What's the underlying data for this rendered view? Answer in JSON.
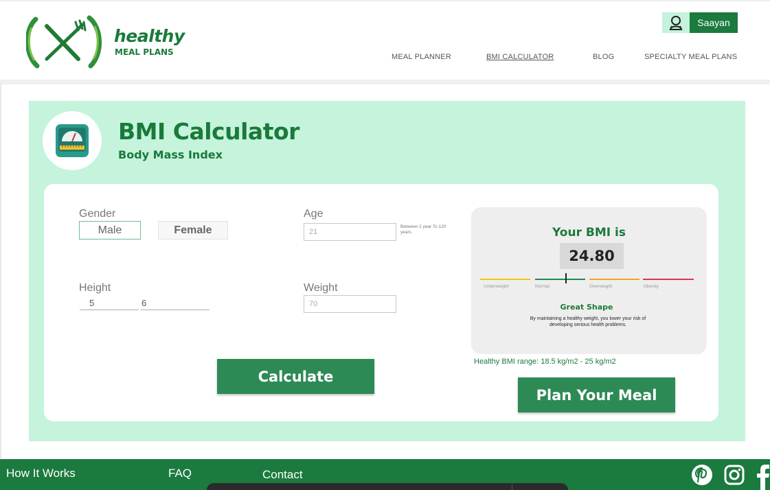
{
  "brand": {
    "word": "healthy",
    "sub": "MEAL PLANS",
    "color": "#1a7a3a"
  },
  "user": {
    "name": "Saayan",
    "icon": "user-icon"
  },
  "nav": [
    {
      "label": "MEAL PLANNER"
    },
    {
      "label": "BMI CALCULATOR",
      "active": true
    },
    {
      "label": "BLOG"
    },
    {
      "label": "SPECIALTY MEAL PLANS"
    }
  ],
  "page": {
    "title": "BMI Calculator",
    "subtitle": "Body Mass Index",
    "icon": "weighing-scale-icon"
  },
  "form": {
    "gender_label": "Gender",
    "gender_options": [
      "Male",
      "Female"
    ],
    "age_label": "Age",
    "age_value": "21",
    "age_hint": "Between 2 year To 120 years",
    "height_label": "Height",
    "height_feet": "5",
    "height_inches": "6",
    "weight_label": "Weight",
    "weight_value": "70",
    "calculate_label": "Calculate"
  },
  "result": {
    "title": "Your BMI is",
    "value": "24.80",
    "categories": [
      "Underweight",
      "Normal",
      "Overwieght",
      "Obesity"
    ],
    "category_colors": [
      "#f2c31a",
      "#1f8a4c",
      "#f0a51e",
      "#e0334a"
    ],
    "status": "Great Shape",
    "description": "By maintaining a healthy weight, you lower your risk of developing serious health problems.",
    "range": "Healthy BMI range: 18.5 kg/m2 - 25 kg/m2"
  },
  "plan_label": "Plan Your Meal",
  "footer": {
    "links": [
      "How It Works",
      "FAQ",
      "Contact"
    ],
    "social": [
      "pinterest-icon",
      "instagram-icon",
      "facebook-icon"
    ]
  }
}
